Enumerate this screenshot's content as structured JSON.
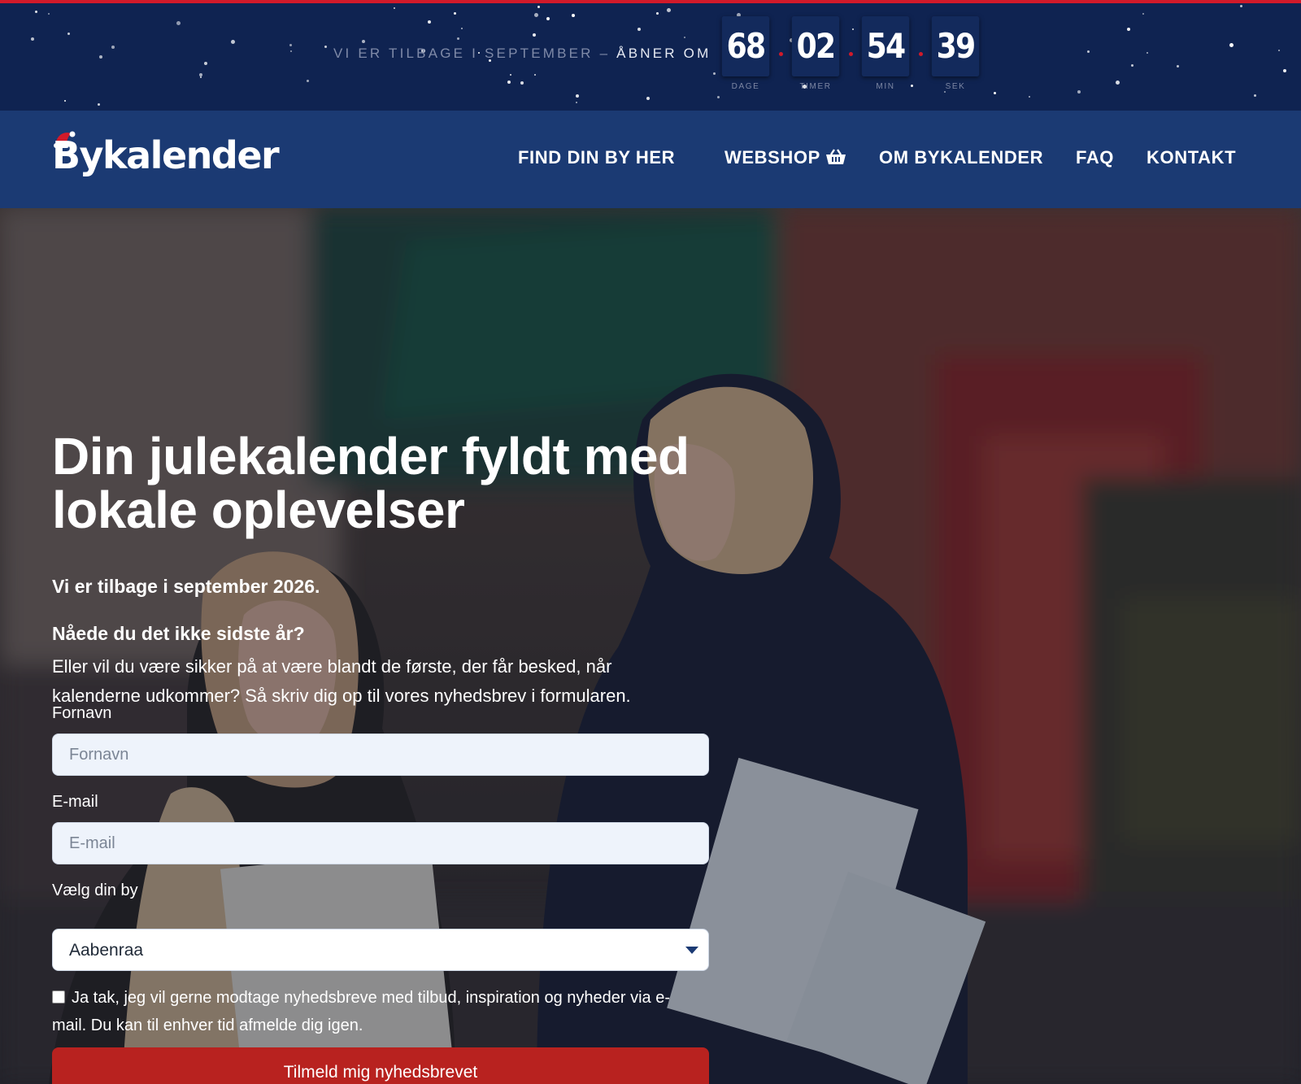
{
  "countdown": {
    "text": "VI ER TILBAGE I SEPTEMBER –",
    "text_accent": "ÅBNER OM",
    "units": [
      {
        "value": "68",
        "label": "DAGE"
      },
      {
        "value": "02",
        "label": "TIMER"
      },
      {
        "value": "54",
        "label": "MIN"
      },
      {
        "value": "39",
        "label": "SEK"
      }
    ]
  },
  "brand": {
    "logo_text": "Bykalender"
  },
  "nav": {
    "items": [
      "FIND DIN BY HER",
      "WEBSHOP",
      "OM BYKALENDER",
      "FAQ",
      "KONTAKT"
    ],
    "webshop_icon": "basket-icon"
  },
  "hero": {
    "title": "Din julekalender fyldt med lokale oplevelser",
    "intro": "Vi er tilbage i september 2026.",
    "question": "Nåede du det ikke sidste år?",
    "description": "Eller vil du være sikker på at være blandt de første, der får besked, når kalenderne udkommer? Så skriv dig op til vores nyhedsbrev i formularen."
  },
  "form": {
    "firstname_label": "Fornavn",
    "firstname_placeholder": "Fornavn",
    "email_label": "E-mail",
    "email_placeholder": "E-mail",
    "city_label": "Vælg din by",
    "city_value": "Aabenraa",
    "consent_text": "Ja tak, jeg vil gerne modtage nyhedsbreve med tilbud, inspiration og nyheder via e-mail. Du kan til enhver tid afmelde dig igen.",
    "submit_label": "Tilmeld mig nyhedsbrevet"
  },
  "colors": {
    "topbar": "#0f2351",
    "navbar": "#1b3a73",
    "accent_red": "#b8221f",
    "countdown_separator": "#d11a2a"
  }
}
